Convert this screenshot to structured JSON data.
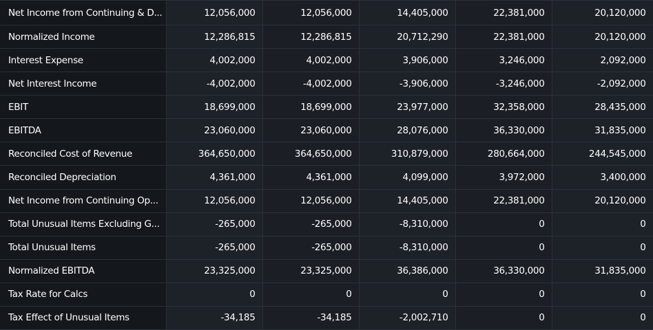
{
  "rows": [
    {
      "label": "Net Income from Continuing & D...",
      "values": [
        "12,056,000",
        "12,056,000",
        "14,405,000",
        "22,381,000",
        "20,120,000"
      ]
    },
    {
      "label": "Normalized Income",
      "values": [
        "12,286,815",
        "12,286,815",
        "20,712,290",
        "22,381,000",
        "20,120,000"
      ]
    },
    {
      "label": "Interest Expense",
      "values": [
        "4,002,000",
        "4,002,000",
        "3,906,000",
        "3,246,000",
        "2,092,000"
      ]
    },
    {
      "label": "Net Interest Income",
      "values": [
        "-4,002,000",
        "-4,002,000",
        "-3,906,000",
        "-3,246,000",
        "-2,092,000"
      ]
    },
    {
      "label": "EBIT",
      "values": [
        "18,699,000",
        "18,699,000",
        "23,977,000",
        "32,358,000",
        "28,435,000"
      ]
    },
    {
      "label": "EBITDA",
      "values": [
        "23,060,000",
        "23,060,000",
        "28,076,000",
        "36,330,000",
        "31,835,000"
      ]
    },
    {
      "label": "Reconciled Cost of Revenue",
      "values": [
        "364,650,000",
        "364,650,000",
        "310,879,000",
        "280,664,000",
        "244,545,000"
      ]
    },
    {
      "label": "Reconciled Depreciation",
      "values": [
        "4,361,000",
        "4,361,000",
        "4,099,000",
        "3,972,000",
        "3,400,000"
      ]
    },
    {
      "label": "Net Income from Continuing Op...",
      "values": [
        "12,056,000",
        "12,056,000",
        "14,405,000",
        "22,381,000",
        "20,120,000"
      ]
    },
    {
      "label": "Total Unusual Items Excluding G...",
      "values": [
        "-265,000",
        "-265,000",
        "-8,310,000",
        "0",
        "0"
      ]
    },
    {
      "label": "Total Unusual Items",
      "values": [
        "-265,000",
        "-265,000",
        "-8,310,000",
        "0",
        "0"
      ]
    },
    {
      "label": "Normalized EBITDA",
      "values": [
        "23,325,000",
        "23,325,000",
        "36,386,000",
        "36,330,000",
        "31,835,000"
      ]
    },
    {
      "label": "Tax Rate for Calcs",
      "values": [
        "0",
        "0",
        "0",
        "0",
        "0"
      ]
    },
    {
      "label": "Tax Effect of Unusual Items",
      "values": [
        "-34,185",
        "-34,185",
        "-2,002,710",
        "0",
        "0"
      ]
    }
  ]
}
